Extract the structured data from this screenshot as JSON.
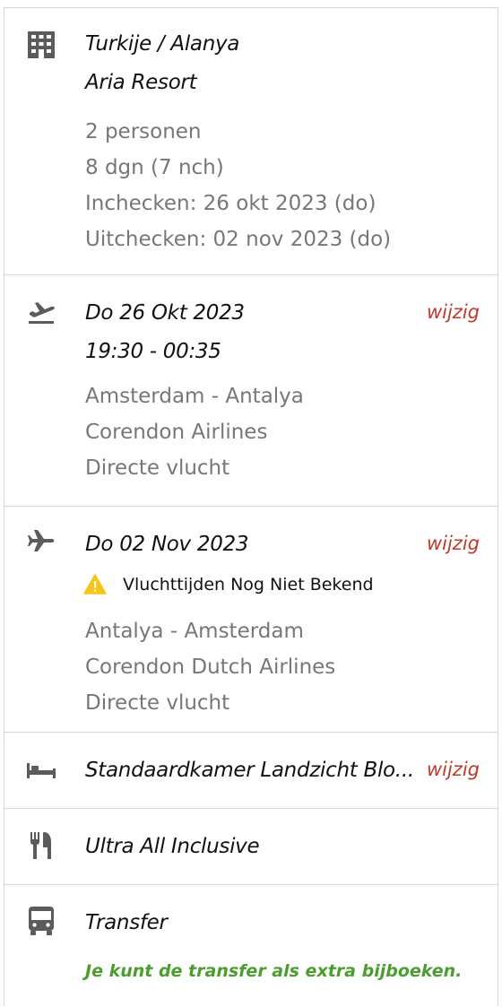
{
  "hotel": {
    "location": "Turkije / Alanya",
    "name": "Aria Resort",
    "persons": "2 personen",
    "duration": "8 dgn (7 nch)",
    "checkin": "Inchecken: 26 okt 2023 (do)",
    "checkout": "Uitchecken: 02 nov 2023 (do)",
    "icon": "building-icon"
  },
  "flight_out": {
    "date": "Do 26 Okt 2023",
    "time": "19:30 - 00:35",
    "route": "Amsterdam - Antalya",
    "airline": "Corendon Airlines",
    "type": "Directe vlucht",
    "change_label": "wijzig",
    "icon": "plane-departure-icon"
  },
  "flight_back": {
    "date": "Do 02 Nov 2023",
    "warning": "Vluchttijden Nog Niet Bekend",
    "route": "Antalya - Amsterdam",
    "airline": "Corendon Dutch Airlines",
    "type": "Directe vlucht",
    "change_label": "wijzig",
    "icon": "plane-return-icon"
  },
  "room": {
    "name": "Standaardkamer Landzicht Blo...",
    "change_label": "wijzig",
    "icon": "bed-icon"
  },
  "board": {
    "name": "Ultra All Inclusive",
    "icon": "cutlery-icon"
  },
  "transfer": {
    "title": "Transfer",
    "note": "Je kunt de transfer als extra bijboeken.",
    "icon": "bus-icon"
  },
  "colors": {
    "accent_red": "#c0392b",
    "green": "#4b9e2d",
    "warning": "#f5c518"
  }
}
